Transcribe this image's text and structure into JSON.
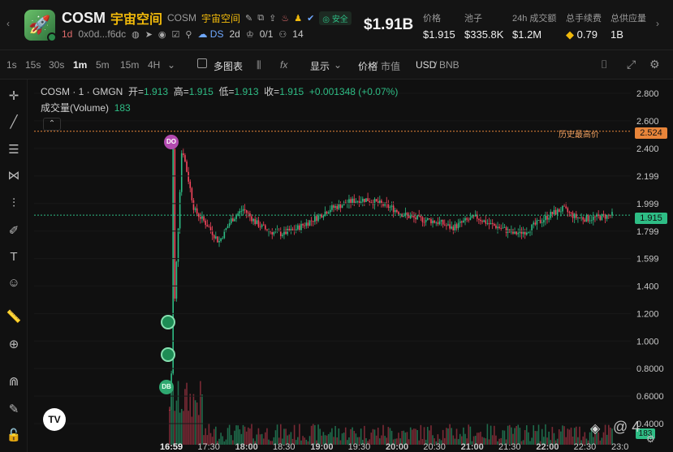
{
  "token": {
    "symbol": "COSM",
    "cn_name": "宇宙空间",
    "symbol_secondary": "COSM",
    "cn_name_secondary": "宇宙空间",
    "safe_label": "安全",
    "age": "1d",
    "address": "0x0d...f6dc",
    "ds_label": "DS",
    "ds_age": "2d",
    "holders_ratio": "0/1",
    "holders_count": "14",
    "market_cap": "$1.91B"
  },
  "stats": [
    {
      "label": "价格",
      "value": "$1.915"
    },
    {
      "label": "池子",
      "value": "$335.8K"
    },
    {
      "label": "24h 成交额",
      "value": "$1.2M"
    },
    {
      "label": "总手续费",
      "value": "0.79"
    },
    {
      "label": "总供应量",
      "value": "1B"
    }
  ],
  "toolbar": {
    "intervals": [
      "1s",
      "15s",
      "30s",
      "1m",
      "5m",
      "15m",
      "4H"
    ],
    "active_interval": "1m",
    "multi_chart": "多图表",
    "display": "显示",
    "price_label": "价格",
    "mcap_label": "市值",
    "quote_usd": "USD",
    "quote_bnb": "BNB"
  },
  "legend": {
    "title": "COSM · 1 · GMGN",
    "open_label": "开=",
    "open": "1.913",
    "high_label": "高=",
    "high": "1.915",
    "low_label": "低=",
    "low": "1.913",
    "close_label": "收=",
    "close": "1.915",
    "change": "+0.001348 (+0.07%)",
    "volume_label": "成交量(Volume)",
    "volume": "183"
  },
  "ath_label": "历史最高价",
  "ath_value": "2.524",
  "current_price_tag": "1.915",
  "volume_tag": "183",
  "markers": [
    "DO",
    "DB"
  ],
  "watermark": "@ 4",
  "chart_data": {
    "type": "candlestick",
    "y_ticks": [
      "2.800",
      "2.600",
      "2.400",
      "2.199",
      "1.999",
      "1.799",
      "1.599",
      "1.400",
      "1.200",
      "1.000",
      "0.8000",
      "0.6000",
      "0.4000"
    ],
    "x_ticks": [
      "16:59",
      "17:30",
      "18:00",
      "18:30",
      "19:00",
      "19:30",
      "20:00",
      "20:30",
      "21:00",
      "21:30",
      "22:00",
      "22:30",
      "23:0"
    ],
    "ylim": [
      0.4,
      2.8
    ],
    "ath": 2.524,
    "last": 1.915,
    "series": [
      {
        "name": "COSM",
        "x": [
          "16:59",
          "17:05",
          "17:10",
          "17:20",
          "17:30",
          "17:40",
          "17:50",
          "18:00",
          "18:10",
          "18:20",
          "18:30",
          "18:40",
          "18:50",
          "19:00",
          "19:10",
          "19:20",
          "19:30",
          "19:40",
          "19:50",
          "20:00",
          "20:10",
          "20:20",
          "20:30",
          "20:40",
          "20:50",
          "21:00",
          "21:10",
          "21:20",
          "21:30",
          "21:40",
          "21:50",
          "22:00",
          "22:10",
          "22:20",
          "22:30",
          "22:40",
          "22:50"
        ],
        "values": [
          0.5,
          2.42,
          1.95,
          1.85,
          1.72,
          1.88,
          1.96,
          1.86,
          1.8,
          1.78,
          1.8,
          1.85,
          1.9,
          1.96,
          1.99,
          2.02,
          2.03,
          2.0,
          1.97,
          1.92,
          1.89,
          1.88,
          1.86,
          1.82,
          1.87,
          1.9,
          1.85,
          1.82,
          1.78,
          1.8,
          1.86,
          1.92,
          1.96,
          1.9,
          1.89,
          1.9,
          1.915
        ]
      }
    ]
  }
}
